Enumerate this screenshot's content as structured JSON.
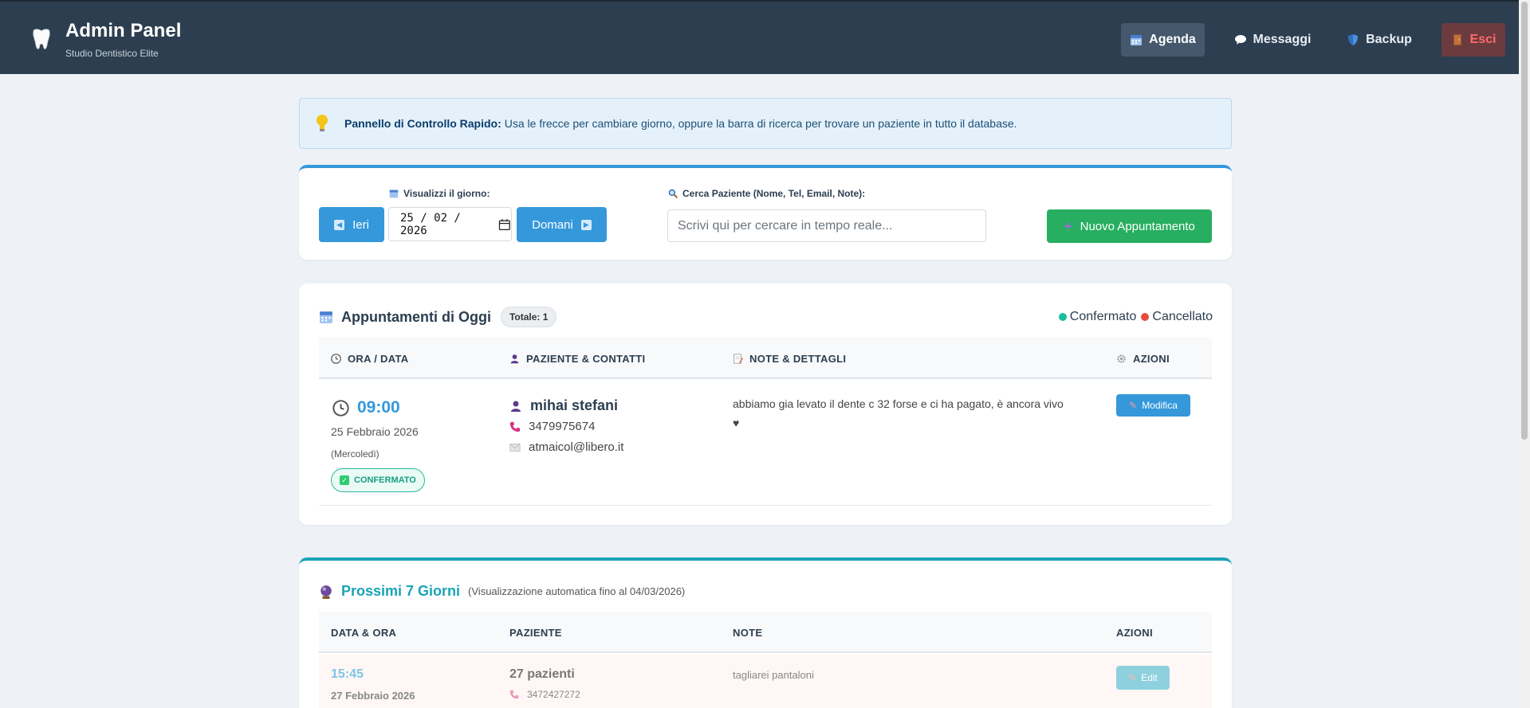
{
  "header": {
    "title": "Admin Panel",
    "subtitle": "Studio Dentistico Elite",
    "nav": [
      {
        "label": "Agenda",
        "icon": "calendar-icon"
      },
      {
        "label": "Messaggi",
        "icon": "speech-bubble-icon"
      },
      {
        "label": "Backup",
        "icon": "shield-icon"
      },
      {
        "label": "Esci",
        "icon": "door-icon"
      }
    ]
  },
  "info": {
    "bold": "Pannello di Controllo Rapido:",
    "text": "Usa le frecce per cambiare giorno, oppure la barra di ricerca per trovare un paziente in tutto il database."
  },
  "controls": {
    "prev_label": "Ieri",
    "next_label": "Domani",
    "date_label": "Visualizzi il giorno:",
    "date_value": "25 / 02 / 2026",
    "search_label": "Cerca Paziente (Nome, Tel, Email, Note):",
    "search_placeholder": "Scrivi qui per cercare in tempo reale...",
    "new_label": "Nuovo Appuntamento"
  },
  "today": {
    "title": "Appuntamenti di Oggi",
    "total": "Totale: 1",
    "legend": [
      "Confermato",
      "Cancellato"
    ],
    "headers": [
      "ORA / DATA",
      "PAZIENTE & CONTATTI",
      "NOTE & DETTAGLI",
      "AZIONI"
    ],
    "rows": [
      {
        "time": "09:00",
        "date": "25 Febbraio 2026",
        "weekday": "(Mercoledì)",
        "status": "CONFERMATO",
        "name": "mihai stefani",
        "phone": "3479975674",
        "email": "atmaicol@libero.it",
        "note": "abbiamo gia levato il dente c 32 forse e ci ha pagato, è ancora vivo",
        "note_symbol": "♥",
        "action": "Modifica"
      }
    ]
  },
  "next": {
    "title": "Prossimi 7 Giorni",
    "subtitle": "(Visualizzazione automatica fino al 04/03/2026)",
    "headers": [
      "DATA & ORA",
      "PAZIENTE",
      "NOTE",
      "AZIONI"
    ],
    "rows": [
      {
        "time": "15:45",
        "date": "27 Febbraio 2026",
        "name": "27 pazienti",
        "phone": "3472427272",
        "note": "tagliarei pantaloni",
        "action": "Edit"
      }
    ]
  },
  "colors": {
    "primary": "#3498db",
    "success": "#27ae60",
    "header_bg": "#2d3e50",
    "confirmed": "#1abc9c",
    "cancelled": "#e74c3c",
    "teal": "#1aa3b5"
  }
}
